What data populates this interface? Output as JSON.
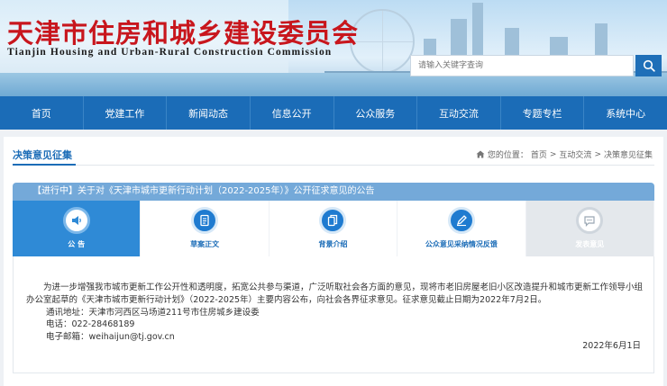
{
  "header": {
    "title": "天津市住房和城乡建设委员会",
    "subtitle": "Tianjin Housing and Urban-Rural Construction Commission",
    "search_placeholder": "请输入关键字查询"
  },
  "nav": {
    "items": [
      {
        "label": "首页"
      },
      {
        "label": "党建工作"
      },
      {
        "label": "新闻动态"
      },
      {
        "label": "信息公开"
      },
      {
        "label": "公众服务"
      },
      {
        "label": "互动交流"
      },
      {
        "label": "专题专栏"
      },
      {
        "label": "系统中心"
      }
    ]
  },
  "page": {
    "section_title": "决策意见征集",
    "breadcrumb": {
      "prefix": "您的位置：",
      "items": [
        "首页",
        "互动交流",
        "决策意见征集"
      ],
      "separator": ">"
    },
    "notice_title": "【进行中】关于对《天津市城市更新行动计划（2022-2025年）》公开征求意见的公告"
  },
  "tabs": [
    {
      "label": "公  告",
      "icon": "speaker-icon",
      "state": "active"
    },
    {
      "label": "草案正文",
      "icon": "document-icon",
      "state": "normal"
    },
    {
      "label": "背景介绍",
      "icon": "files-icon",
      "state": "normal"
    },
    {
      "label": "公众意见采纳情况反馈",
      "icon": "pen-icon",
      "state": "normal"
    },
    {
      "label": "发表意见",
      "icon": "chat-icon",
      "state": "disabled"
    }
  ],
  "content": {
    "paragraph": "为进一步增强我市城市更新工作公开性和透明度，拓宽公共参与渠道，广泛听取社会各方面的意见，现将市老旧房屋老旧小区改造提升和城市更新工作领导小组办公室起草的《天津市城市更新行动计划》（2022-2025年）主要内容公布，向社会各界征求意见。征求意见截止日期为2022年7月2日。",
    "address": "通讯地址：天津市河西区马场道211号市住房城乡建设委",
    "phone": "电话：022-28468189",
    "email": "电子邮箱：weihaijun@tj.gov.cn",
    "date": "2022年6月1日"
  },
  "colors": {
    "brand_red": "#c8161d",
    "nav_blue": "#1b6cb7",
    "notice_bar": "#74a9d9",
    "active_tab": "#2f8ad6"
  }
}
